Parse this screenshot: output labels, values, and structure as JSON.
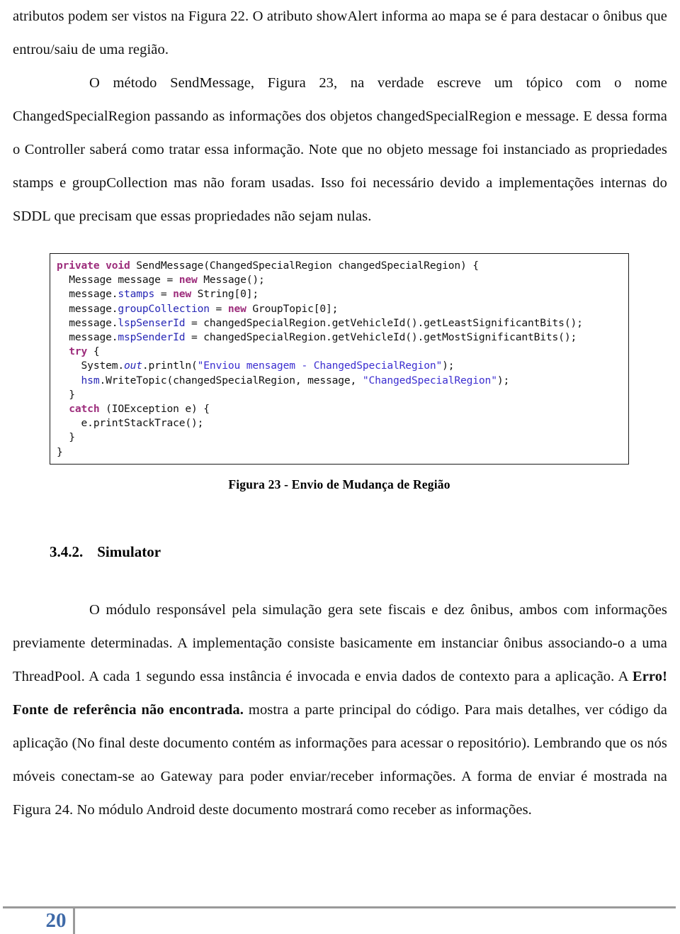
{
  "document": {
    "page_number": "20"
  },
  "paragraphs": {
    "p1": "atributos podem ser vistos na Figura 22. O atributo showAlert informa ao mapa se é para destacar o ônibus que entrou/saiu de uma região.",
    "p2": "O método SendMessage, Figura 23, na verdade escreve um tópico com o nome ChangedSpecialRegion passando as informações dos objetos changedSpecialRegion e message. E dessa forma o Controller saberá como tratar essa informação. Note que no objeto message foi instanciado as propriedades stamps e groupCollection mas não foram usadas. Isso foi necessário devido a implementações internas do SDDL que precisam que essas propriedades não sejam nulas.",
    "p3_before_error": "O módulo responsável pela simulação gera sete fiscais e dez ônibus, ambos com informações previamente determinadas. A implementação consiste basicamente em instanciar ônibus associando-o a uma ThreadPool. A cada 1 segundo essa instância é invocada e envia dados de contexto para a aplicação. A ",
    "p3_error": "Erro! Fonte de referência não encontrada.",
    "p3_after_error": " mostra a parte principal do código. Para mais detalhes, ver código da aplicação (No final deste documento contém as informações para acessar o repositório). Lembrando que os nós móveis conectam-se ao Gateway para poder enviar/receber informações. A forma de enviar é mostrada na Figura 24. No módulo Android deste documento mostrará como receber as informações."
  },
  "figure": {
    "caption": "Figura 23 - Envio de Mudança de Região",
    "code_lines": [
      [
        {
          "t": "private void ",
          "c": "k"
        },
        {
          "t": "SendMessage(ChangedSpecialRegion changedSpecialRegion) {",
          "c": "pl"
        }
      ],
      [
        {
          "t": "  Message message = ",
          "c": "pl"
        },
        {
          "t": "new ",
          "c": "k"
        },
        {
          "t": "Message();",
          "c": "pl"
        }
      ],
      [
        {
          "t": "  message.",
          "c": "pl"
        },
        {
          "t": "stamps",
          "c": "fld"
        },
        {
          "t": " = ",
          "c": "pl"
        },
        {
          "t": "new ",
          "c": "k"
        },
        {
          "t": "String[0];",
          "c": "pl"
        }
      ],
      [
        {
          "t": "  message.",
          "c": "pl"
        },
        {
          "t": "groupCollection",
          "c": "fld"
        },
        {
          "t": " = ",
          "c": "pl"
        },
        {
          "t": "new ",
          "c": "k"
        },
        {
          "t": "GroupTopic[0];",
          "c": "pl"
        }
      ],
      [
        {
          "t": "  message.",
          "c": "pl"
        },
        {
          "t": "lspSenserId",
          "c": "fld"
        },
        {
          "t": " = changedSpecialRegion.getVehicleId().getLeastSignificantBits();",
          "c": "pl"
        }
      ],
      [
        {
          "t": "  message.",
          "c": "pl"
        },
        {
          "t": "mspSenderId",
          "c": "fld"
        },
        {
          "t": " = changedSpecialRegion.getVehicleId().getMostSignificantBits();",
          "c": "pl"
        }
      ],
      [
        {
          "t": "  try ",
          "c": "k"
        },
        {
          "t": "{",
          "c": "pl"
        }
      ],
      [
        {
          "t": "    System.",
          "c": "pl"
        },
        {
          "t": "out",
          "c": "stat"
        },
        {
          "t": ".println(",
          "c": "pl"
        },
        {
          "t": "\"Enviou mensagem - ChangedSpecialRegion\"",
          "c": "str"
        },
        {
          "t": ");",
          "c": "pl"
        }
      ],
      [
        {
          "t": "    hsm",
          "c": "fld"
        },
        {
          "t": ".WriteTopic(changedSpecialRegion, message, ",
          "c": "pl"
        },
        {
          "t": "\"ChangedSpecialRegion\"",
          "c": "str"
        },
        {
          "t": ");",
          "c": "pl"
        }
      ],
      [
        {
          "t": "  }",
          "c": "pl"
        }
      ],
      [
        {
          "t": "  catch ",
          "c": "k"
        },
        {
          "t": "(IOException e) {",
          "c": "pl"
        }
      ],
      [
        {
          "t": "    e.printStackTrace();",
          "c": "pl"
        }
      ],
      [
        {
          "t": "  }",
          "c": "pl"
        }
      ],
      [
        {
          "t": "}",
          "c": "pl"
        }
      ]
    ]
  },
  "section": {
    "number": "3.4.2.",
    "title": "Simulator"
  },
  "colors": {
    "keyword": "#9d2d7c",
    "field": "#2626b5",
    "string": "#3b2ed0",
    "page_number": "#3f6aa8",
    "footer_rule": "#9a9a9a"
  }
}
